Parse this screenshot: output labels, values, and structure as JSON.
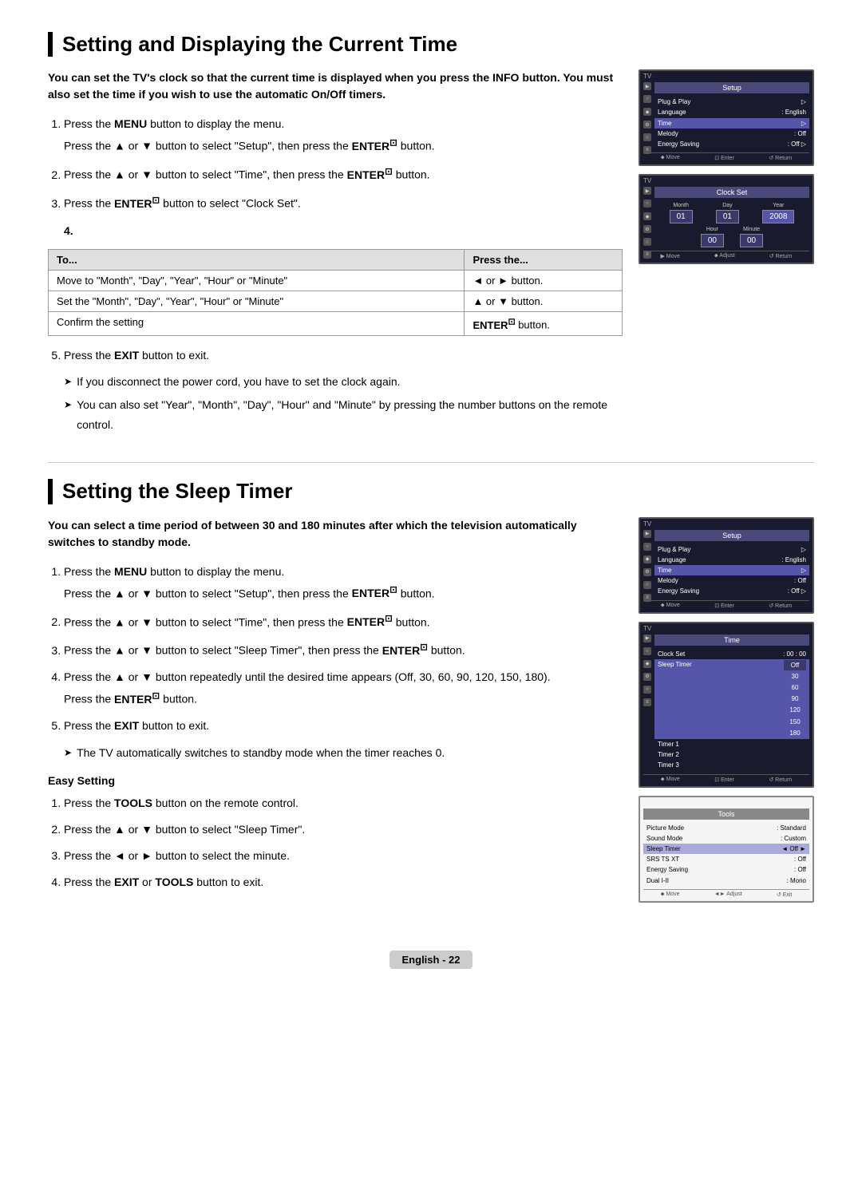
{
  "section1": {
    "title": "Setting and Displaying the Current Time",
    "intro": "You can set the TV's clock so that the current time is displayed when you press the INFO button. You must also set the time if you wish to use the automatic On/Off timers.",
    "steps": [
      {
        "number": "1.",
        "text_parts": [
          "Press the ",
          "MENU",
          " button to display the menu.",
          "\nPress the ▲ or ▼ button to select \"Setup\", then press the ",
          "ENTER",
          " button."
        ]
      },
      {
        "number": "2.",
        "text_parts": [
          "Press the ▲ or ▼ button to select \"Time\", then press the ",
          "ENTER",
          " button."
        ]
      },
      {
        "number": "3.",
        "text_parts": [
          "Press the ",
          "ENTER",
          " button to select \"Clock Set\"."
        ]
      }
    ],
    "step4_label": "4.",
    "table_col1": "To...",
    "table_col2": "Press the...",
    "table_rows": [
      {
        "to": "Move to \"Month\", \"Day\", \"Year\", \"Hour\" or \"Minute\"",
        "press": "◄ or ► button."
      },
      {
        "to": "Set the \"Month\", \"Day\", \"Year\", \"Hour\" or \"Minute\"",
        "press": "▲ or ▼ button."
      },
      {
        "to": "Confirm the setting",
        "press": "ENTER button."
      }
    ],
    "step5": {
      "text_parts": [
        "Press the ",
        "EXIT",
        " button to exit."
      ]
    },
    "notes": [
      "If you disconnect the power cord, you have to set the clock again.",
      "You can also set \"Year\", \"Month\", \"Day\", \"Hour\" and \"Minute\" by pressing the number buttons on the remote control."
    ],
    "screen1": {
      "tv_label": "TV",
      "menu_title": "Setup",
      "rows": [
        {
          "label": "Plug & Play",
          "value": "",
          "highlighted": false
        },
        {
          "label": "Language",
          "value": ": English",
          "highlighted": false
        },
        {
          "label": "Time",
          "value": "",
          "highlighted": true
        },
        {
          "label": "Melody",
          "value": ": Off",
          "highlighted": false
        },
        {
          "label": "Energy Saving",
          "value": ": Off",
          "highlighted": false
        }
      ],
      "bottom": [
        "⬥ Move",
        "⊡ Enter",
        "↺ Return"
      ]
    },
    "screen2": {
      "tv_label": "TV",
      "menu_title": "Clock Set",
      "labels_row1": [
        "Month",
        "Day",
        "Year"
      ],
      "values_row1": [
        "01",
        "01",
        "2008"
      ],
      "labels_row2": [
        "Hour",
        "Minute"
      ],
      "values_row2": [
        "00",
        "00"
      ],
      "bottom": [
        "▶ Move",
        "⬥ Adjust",
        "↺ Return"
      ]
    }
  },
  "section2": {
    "title": "Setting the Sleep Timer",
    "intro": "You can select a time period of between 30 and 180 minutes after which the television automatically switches to standby mode.",
    "steps": [
      {
        "number": "1.",
        "text_parts": [
          "Press the ",
          "MENU",
          " button to display the menu.",
          "\nPress the ▲ or ▼ button to select \"Setup\", then press the ",
          "ENTER",
          " button."
        ]
      },
      {
        "number": "2.",
        "text_parts": [
          "Press the ▲ or ▼ button to select \"Time\", then press the ",
          "ENTER",
          " button."
        ]
      },
      {
        "number": "3.",
        "text_parts": [
          "Press the ▲ or ▼ button to select \"Sleep Timer\", then press the ",
          "ENTER",
          " button."
        ]
      },
      {
        "number": "4.",
        "text_parts": [
          "Press the ▲ or ▼ button repeatedly until the desired time appears (Off, 30, 60, 90, 120, 150, 180).",
          "\nPress the ",
          "ENTER",
          " button."
        ]
      },
      {
        "number": "5.",
        "text_parts": [
          "Press the ",
          "EXIT",
          " button to exit."
        ]
      }
    ],
    "note": "The TV automatically switches to standby mode when the timer reaches 0.",
    "easy_setting_title": "Easy Setting",
    "easy_steps": [
      {
        "number": "1.",
        "text_parts": [
          "Press the ",
          "TOOLS",
          " button on the remote control."
        ]
      },
      {
        "number": "2.",
        "text": "Press the ▲ or ▼ button to select \"Sleep Timer\"."
      },
      {
        "number": "3.",
        "text": "Press the ◄ or ► button to select the minute."
      },
      {
        "number": "4.",
        "text_parts": [
          "Press the ",
          "EXIT",
          " or ",
          "TOOLS",
          " button to exit."
        ]
      }
    ],
    "screen1": {
      "tv_label": "TV",
      "menu_title": "Setup",
      "rows": [
        {
          "label": "Plug & Play",
          "value": "",
          "highlighted": false
        },
        {
          "label": "Language",
          "value": ": English",
          "highlighted": false
        },
        {
          "label": "Time",
          "value": "",
          "highlighted": true
        },
        {
          "label": "Melody",
          "value": ": Off",
          "highlighted": false
        },
        {
          "label": "Energy Saving",
          "value": ": Off",
          "highlighted": false
        }
      ],
      "bottom": [
        "⬥ Move",
        "⊡ Enter",
        "↺ Return"
      ]
    },
    "screen2": {
      "tv_label": "TV",
      "menu_title": "Time",
      "rows": [
        {
          "label": "Clock Set",
          "value": ": 00 : 00",
          "highlighted": false
        },
        {
          "label": "Sleep Timer",
          "value": "",
          "highlighted": true
        },
        {
          "label": "Timer 1",
          "value": "",
          "highlighted": false
        },
        {
          "label": "Timer 2",
          "value": "",
          "highlighted": false
        },
        {
          "label": "Timer 3",
          "value": "",
          "highlighted": false
        }
      ],
      "timer_values": [
        "Off",
        "30",
        "60",
        "90",
        "120",
        "150",
        "180"
      ],
      "bottom": [
        "⬥ Move",
        "⊡ Enter",
        "↺ Return"
      ]
    },
    "screen3": {
      "menu_title": "Tools",
      "rows": [
        {
          "label": "Picture Mode",
          "value": ": Standard",
          "highlighted": false
        },
        {
          "label": "Sound Mode",
          "value": ": Custom",
          "highlighted": false
        },
        {
          "label": "Sleep Timer",
          "value": "◄ Off  ►",
          "highlighted": true
        },
        {
          "label": "SRS TS XT",
          "value": ": Off",
          "highlighted": false
        },
        {
          "label": "Energy Saving",
          "value": ": Off",
          "highlighted": false
        },
        {
          "label": "Dual I-II",
          "value": ": Mono",
          "highlighted": false
        }
      ],
      "bottom": [
        "⬥ Move",
        "◄► Adjust",
        "↺ Exit"
      ]
    }
  },
  "footer": {
    "text": "English - 22"
  }
}
